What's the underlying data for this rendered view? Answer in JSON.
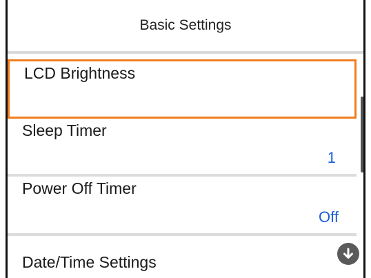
{
  "header": {
    "title": "Basic Settings"
  },
  "items": [
    {
      "label": "LCD Brightness",
      "value": ""
    },
    {
      "label": "Sleep Timer",
      "value": "1"
    },
    {
      "label": "Power Off Timer",
      "value": "Off"
    },
    {
      "label": "Date/Time Settings",
      "value": ""
    }
  ],
  "colors": {
    "selection": "#f07e1f",
    "value_text": "#1a5ed8"
  },
  "icons": {
    "scroll_down": "arrow-down-circle-icon"
  }
}
